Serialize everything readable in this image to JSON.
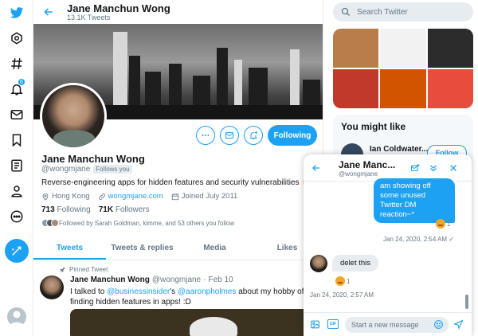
{
  "header": {
    "name": "Jane Manchun Wong",
    "tweet_count": "13.1K Tweets"
  },
  "profile": {
    "name": "Jane Manchun Wong",
    "handle": "@wongmjane",
    "follows_you": "Follows you",
    "bio": "Reverse-engineering apps for hidden features and security vulnerabilities",
    "location": "Hong Kong",
    "website": "wongmjane.com",
    "joined": "Joined July 2011",
    "following_count": "713",
    "following_label": "Following",
    "followers_count": "71K",
    "followers_label": "Followers",
    "followed_by": "Followed by Sarah Goldman, kimme, and 53 others you follow",
    "following_button": "Following"
  },
  "tabs": [
    {
      "label": "Tweets",
      "active": true
    },
    {
      "label": "Tweets & replies"
    },
    {
      "label": "Media"
    },
    {
      "label": "Likes"
    }
  ],
  "tweet": {
    "pinned_label": "Pinned Tweet",
    "name": "Jane Manchun Wong",
    "handle": "@wongmjane",
    "dot": "·",
    "date": "Feb 10",
    "text_1": "I talked to ",
    "mention_1": "@businessinsider",
    "text_2": "'s ",
    "mention_2": "@aaronpholmes",
    "text_3": " about my hobby  of finding hidden features in apps! :D"
  },
  "search": {
    "placeholder": "Search Twitter"
  },
  "you_might_like": {
    "title": "You might like",
    "suggestion_name": "Ian Coldwater...",
    "follow_button": "Follow"
  },
  "dm": {
    "name": "Jane Manc...",
    "handle": "@wongmjane",
    "outgoing_text": "am showing off some unused Twitter DM reaction~*",
    "reaction_count_1": "1",
    "timestamp_1": "Jan 24, 2020, 2:54 AM ✓",
    "incoming_text": "delet this",
    "reaction_count_2": "1",
    "timestamp_2": "Jan 24, 2020, 2:57 AM",
    "input_placeholder": "Start a new message",
    "gif_label": "GIF"
  },
  "colors": {
    "accent": "#1da1f2",
    "text": "#14171a",
    "secondary": "#657786",
    "border": "#e6ecf0"
  },
  "icons": [
    "twitter-logo-icon",
    "explore-icon",
    "hashtag-icon",
    "notifications-icon",
    "messages-icon",
    "bookmarks-icon",
    "lists-icon",
    "profile-icon",
    "more-icon",
    "compose-icon"
  ],
  "nav": {
    "notification_badge": "6"
  }
}
